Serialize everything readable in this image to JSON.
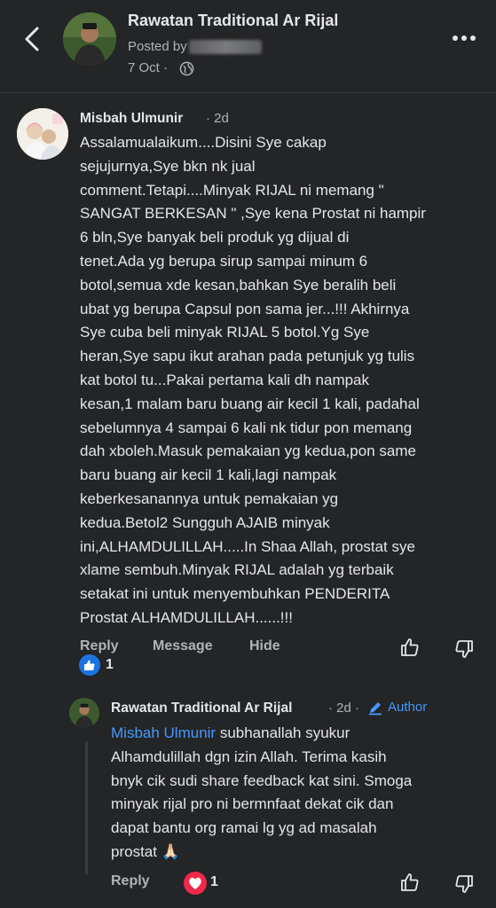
{
  "header": {
    "page_name": "Rawatan Traditional Ar Rijal",
    "posted_by_label": "Posted by",
    "date": "7 Oct",
    "date_separator": "·"
  },
  "comment": {
    "author": "Misbah Ulmunir",
    "time": "· 2d",
    "lines": [
      "Assalamualaikum....Disini Sye cakap",
      "sejujurnya,Sye bkn nk jual",
      "comment.Tetapi....Minyak RIJAL ni memang \"",
      "SANGAT BERKESAN \" ,Sye kena Prostat ni hampir",
      "6 bln,Sye banyak beli produk yg dijual di",
      "tenet.Ada yg berupa sirup sampai minum 6",
      "botol,semua xde kesan,bahkan Sye beralih beli",
      "ubat yg berupa Capsul pon sama jer...!!! Akhirnya",
      "Sye cuba beli minyak RIJAL 5 botol.Yg Sye",
      "heran,Sye sapu ikut arahan pada petunjuk yg tulis",
      "kat botol tu...Pakai pertama kali dh nampak",
      "kesan,1 malam baru buang air kecil 1 kali, padahal",
      "sebelumnya 4 sampai 6 kali nk tidur pon memang",
      "dah xboleh.Masuk pemakaian yg kedua,pon same",
      "baru buang air kecil 1 kali,lagi nampak",
      "keberkesanannya untuk pemakaian yg",
      "kedua.Betol2 Sungguh AJAIB minyak",
      "ini,ALHAMDULILLAH.....In Shaa Allah, prostat sye",
      "xlame sembuh.Minyak RIJAL adalah yg terbaik",
      "setakat ini untuk menyembuhkan PENDERITA",
      "Prostat ALHAMDULILLAH......!!!"
    ],
    "actions": {
      "reply": "Reply",
      "message": "Message",
      "hide": "Hide"
    },
    "reaction_count": "1"
  },
  "reply": {
    "author": "Rawatan Traditional Ar Rijal",
    "time": "· 2d ·",
    "badge": "Author",
    "mention": "Misbah Ulmunir",
    "first_line_rest": " subhanallah syukur",
    "lines": [
      "Alhamdulillah dgn izin Allah. Terima kasih",
      "bnyk cik sudi share feedback kat sini. Smoga",
      "minyak rijal pro ni bermnfaat dekat cik dan",
      "dapat bantu org ramai lg yg ad masalah",
      "prostat"
    ],
    "emoji": "🙏🏻",
    "actions": {
      "reply": "Reply"
    },
    "reaction_count": "1"
  },
  "colors": {
    "background": "#242526",
    "text": "#e4e6eb",
    "muted": "#b0b3b8",
    "accent": "#4599ff",
    "like": "#1b74e4",
    "love": "#f02849"
  }
}
